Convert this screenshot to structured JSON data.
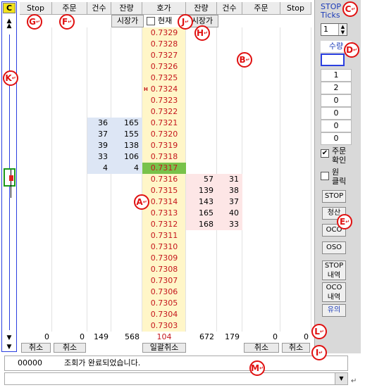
{
  "window": {
    "title_label": "C"
  },
  "headers": [
    "Stop",
    "주문",
    "건수",
    "잔량",
    "호가",
    "잔량",
    "건수",
    "주문",
    "Stop"
  ],
  "subrow": {
    "market_left": "시장가",
    "current_checkbox_label": "현재",
    "market_right": "시장가"
  },
  "prices": [
    "0.7329",
    "0.7328",
    "0.7327",
    "0.7326",
    "0.7325",
    "0.7324",
    "0.7323",
    "0.7322",
    "0.7321",
    "0.7320",
    "0.7319",
    "0.7318",
    "0.7317",
    "0.7316",
    "0.7315",
    "0.7314",
    "0.7313",
    "0.7312",
    "0.7311",
    "0.7310",
    "0.7309",
    "0.7308",
    "0.7307",
    "0.7306",
    "0.7305",
    "0.7304",
    "0.7303"
  ],
  "current_price_marker": "H",
  "bid_side": [
    {
      "count": "36",
      "qty": "165"
    },
    {
      "count": "37",
      "qty": "155"
    },
    {
      "count": "39",
      "qty": "138"
    },
    {
      "count": "33",
      "qty": "106"
    },
    {
      "count": "4",
      "qty": "4"
    }
  ],
  "ask_side": [
    {
      "qty": "57",
      "count": "31"
    },
    {
      "qty": "139",
      "count": "38"
    },
    {
      "qty": "143",
      "count": "37"
    },
    {
      "qty": "165",
      "count": "40"
    },
    {
      "qty": "168",
      "count": "33"
    }
  ],
  "footer": {
    "stop_left": "0",
    "order_left": "0",
    "count_left": "149",
    "qty_left": "568",
    "center": "104",
    "qty_right": "672",
    "count_right": "179",
    "order_right": "0",
    "stop_right": "0"
  },
  "cancel_row": {
    "cancel_stop_left": "취소",
    "cancel_order_left": "취소",
    "cancel_all": "일괄취소",
    "cancel_order_right": "취소",
    "cancel_stop_right": "취소"
  },
  "right_panel": {
    "stop_ticks_label_1": "STOP",
    "stop_ticks_label_2": "Ticks",
    "stop_ticks_value": "1",
    "qty_label": "수량",
    "qty_input": "",
    "qty_presets": [
      "1",
      "2",
      "0",
      "0",
      "0",
      "0"
    ],
    "order_confirm_1": "주문",
    "order_confirm_2": "확인",
    "one_click_1": "원",
    "one_click_2": "클릭",
    "btn_stop": "STOP",
    "btn_liquidate": "청산",
    "btn_oco": "OCO",
    "btn_oso": "OSO",
    "btn_stop_history_1": "STOP",
    "btn_stop_history_2": "내역",
    "btn_oco_history_1": "OCO",
    "btn_oco_history_2": "내역",
    "btn_notice": "유의"
  },
  "message": {
    "code": "00000",
    "text": "조회가 완료되었습니다."
  },
  "markers": [
    "A",
    "B",
    "C",
    "D",
    "E",
    "F",
    "G",
    "H",
    "I",
    "J",
    "K",
    "L",
    "M"
  ],
  "marker_suffix": "↵",
  "colors": {
    "price_red": "#c4161c",
    "bid_blue": "#dde6f5",
    "ask_pink": "#fde6e6",
    "current_green": "#78c24a",
    "marker_red": "#e01010"
  }
}
